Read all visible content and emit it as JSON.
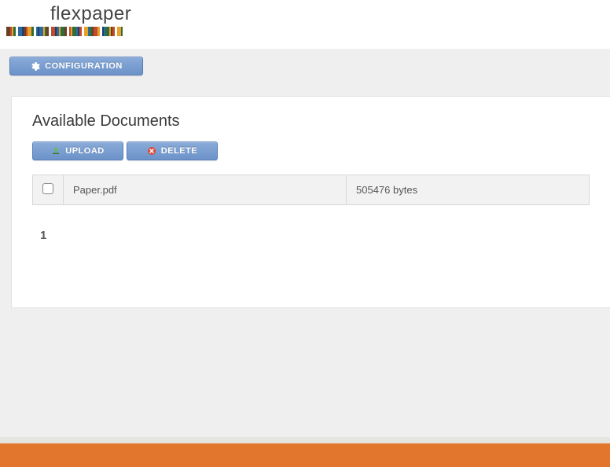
{
  "brand": {
    "name": "flexpaper"
  },
  "barcode_colors": [
    "#6b3f25",
    "#c24b2d",
    "#e8a12b",
    "#2f6d3a",
    "#2d6aa0",
    "#1d3e6b",
    "#6b3f25",
    "#c24b2d",
    "#e8a12b",
    "#2f6d3a",
    "#2d6aa0",
    "#1d3e6b",
    "#2d6aa0",
    "#e8a12b",
    "#2f6d3a",
    "#6b3f25",
    "#c24b2d",
    "#1d3e6b",
    "#2d6aa0",
    "#e8a12b",
    "#2f6d3a",
    "#6b3f25",
    "#c24b2d",
    "#e8a12b",
    "#2f6d3a",
    "#2d6aa0",
    "#1d3e6b",
    "#c24b2d",
    "#e8a12b",
    "#2d6aa0",
    "#2f6d3a",
    "#6b3f25",
    "#c24b2d",
    "#e8a12b",
    "#1d3e6b",
    "#2d6aa0",
    "#2f6d3a",
    "#e8a12b",
    "#6b3f25",
    "#c24b2d",
    "#e8a12b",
    "#2f6d3a"
  ],
  "nav": {
    "configuration": "CONFIGURATION"
  },
  "panel": {
    "title": "Available Documents",
    "upload": "UPLOAD",
    "delete": "DELETE"
  },
  "documents": [
    {
      "name": "Paper.pdf",
      "size": "505476 bytes"
    }
  ],
  "pager": {
    "page": "1"
  }
}
